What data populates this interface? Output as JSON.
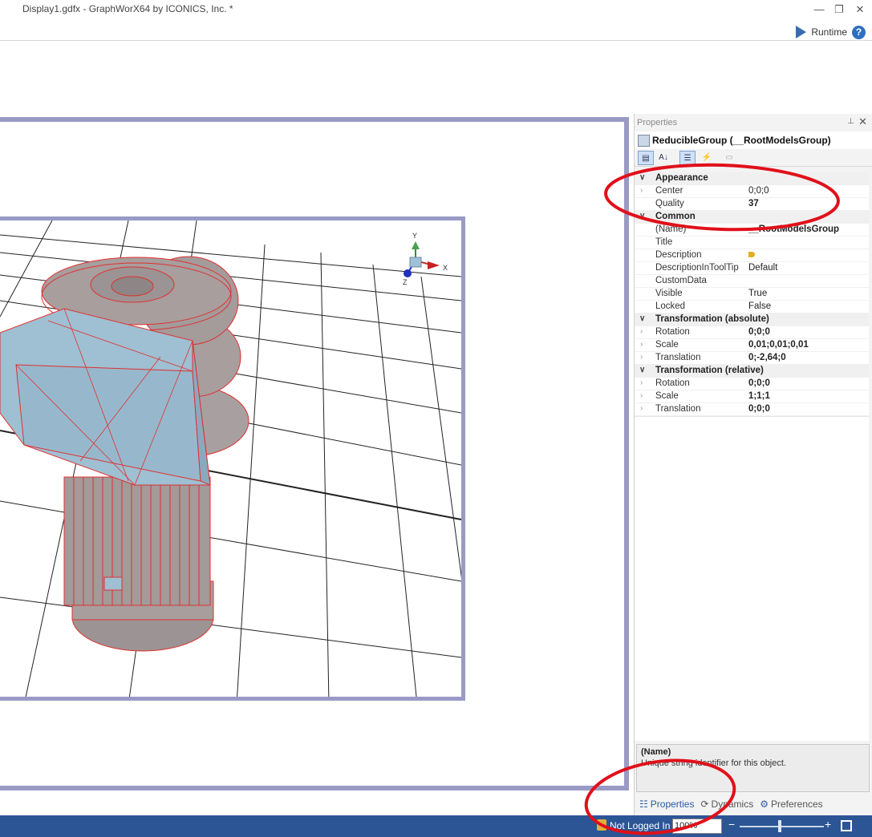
{
  "window": {
    "title": "Display1.gdfx - GraphWorX64 by ICONICS, Inc. *",
    "minimize_glyph": "—",
    "restore_glyph": "❐",
    "close_glyph": "✕",
    "runtime_label": "Runtime",
    "help_glyph": "?"
  },
  "properties": {
    "panel_title": "Properties",
    "pin_glyph": "⊥",
    "close_glyph": "✕",
    "object_name": "ReducibleGroup  (__RootModelsGroup)",
    "toolbar": {
      "categorized": "▤",
      "alphabetical": "A↓",
      "properties": "☰",
      "events": "⚡",
      "pages": "▭"
    },
    "categories": [
      {
        "label": "Appearance",
        "rows": [
          {
            "name": "Center",
            "value": "0;0;0",
            "bold": false,
            "expandable": true
          },
          {
            "name": "Quality",
            "value": "37",
            "bold": true,
            "expandable": false
          }
        ]
      },
      {
        "label": "Common",
        "rows": [
          {
            "name": "(Name)",
            "value": "__RootModelsGroup",
            "bold": true,
            "expandable": false
          },
          {
            "name": "Title",
            "value": "",
            "bold": false,
            "expandable": false
          },
          {
            "name": "Description",
            "value": "",
            "bold": false,
            "expandable": false,
            "dot": true
          },
          {
            "name": "DescriptionInToolTip",
            "value": "Default",
            "bold": false,
            "expandable": false
          },
          {
            "name": "CustomData",
            "value": "",
            "bold": false,
            "expandable": false
          },
          {
            "name": "Visible",
            "value": "True",
            "bold": false,
            "expandable": false
          },
          {
            "name": "Locked",
            "value": "False",
            "bold": false,
            "expandable": false
          }
        ]
      },
      {
        "label": "Transformation (absolute)",
        "rows": [
          {
            "name": "Rotation",
            "value": "0;0;0",
            "bold": true,
            "expandable": true
          },
          {
            "name": "Scale",
            "value": "0,01;0,01;0,01",
            "bold": true,
            "expandable": true
          },
          {
            "name": "Translation",
            "value": "0;-2,64;0",
            "bold": true,
            "expandable": true
          }
        ]
      },
      {
        "label": "Transformation (relative)",
        "rows": [
          {
            "name": "Rotation",
            "value": "0;0;0",
            "bold": true,
            "expandable": true
          },
          {
            "name": "Scale",
            "value": "1;1;1",
            "bold": true,
            "expandable": true
          },
          {
            "name": "Translation",
            "value": "0;0;0",
            "bold": true,
            "expandable": true
          }
        ]
      }
    ],
    "help_title": "(Name)",
    "help_desc": "Unique string identifier for this object.",
    "tabs": [
      {
        "label": "Properties",
        "icon": "☷",
        "active": true
      },
      {
        "label": "Dynamics",
        "icon": "⟳",
        "active": false
      },
      {
        "label": "Preferences",
        "icon": "⚙",
        "active": false
      }
    ]
  },
  "axes": {
    "x": "X",
    "y": "Y",
    "z": "Z"
  },
  "status": {
    "login": "Not Logged In",
    "zoom": "100%",
    "minus": "−",
    "plus": "+"
  },
  "colors": {
    "frame": "#9a9ac6",
    "statusbar": "#2c5596",
    "annotation": "#e0101a",
    "model_fill": "#a89e9e",
    "model_edge": "#e03030",
    "box_fill": "#9fbfd2"
  },
  "icons": [
    "play-icon",
    "help-icon",
    "pin-icon",
    "close-icon",
    "lock-icon",
    "fit-icon",
    "gear-icon"
  ]
}
